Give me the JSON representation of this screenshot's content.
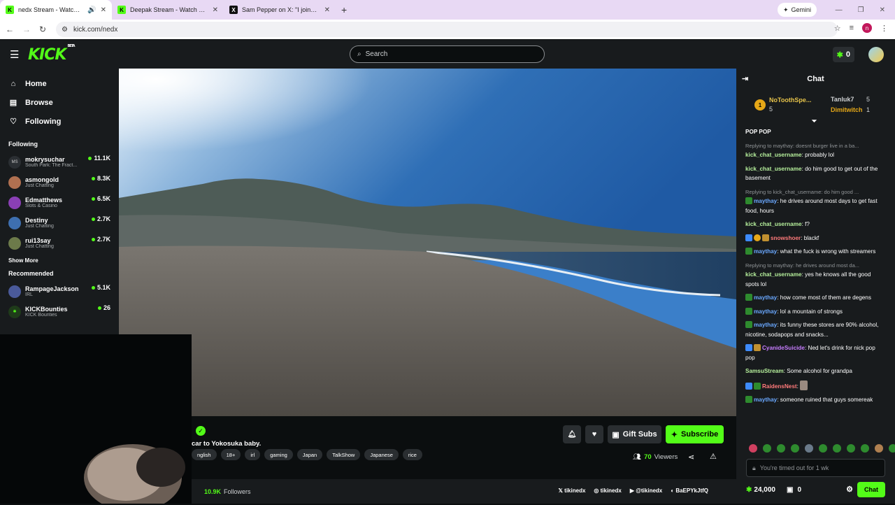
{
  "browser": {
    "tabs": [
      {
        "title": "nedx Stream - Watch Live o",
        "icon": "K"
      },
      {
        "title": "Deepak Stream - Watch Live o",
        "icon": "K"
      },
      {
        "title": "Sam Pepper on X: \"I joined a tr",
        "icon": "X"
      }
    ],
    "new_tab": "+",
    "gemini_label": "Gemini",
    "url": "kick.com/nedx",
    "profile_initial": "n"
  },
  "header": {
    "logo": "KICK",
    "logo_tag": "BETA",
    "search_placeholder": "Search",
    "kicks_count": "0"
  },
  "sidebar": {
    "nav": [
      {
        "label": "Home",
        "icon": "home-icon"
      },
      {
        "label": "Browse",
        "icon": "browse-icon"
      },
      {
        "label": "Following",
        "icon": "heart-icon"
      }
    ],
    "following_title": "Following",
    "following": [
      {
        "name": "mokrysuchar",
        "category": "South Park: The Fract...",
        "viewers": "11.1K",
        "initials": "MS"
      },
      {
        "name": "asmongold",
        "category": "Just Chatting",
        "viewers": "8.3K",
        "initials": ""
      },
      {
        "name": "Edmatthews",
        "category": "Slots & Casino",
        "viewers": "6.5K",
        "initials": ""
      },
      {
        "name": "Destiny",
        "category": "Just Chatting",
        "viewers": "2.7K",
        "initials": ""
      },
      {
        "name": "rui13say",
        "category": "Just Chatting",
        "viewers": "2.7K",
        "initials": ""
      }
    ],
    "show_more": "Show More",
    "recommended_title": "Recommended",
    "recommended": [
      {
        "name": "RampageJackson",
        "category": "IRL",
        "viewers": "5.1K",
        "initials": ""
      },
      {
        "name": "KICKBounties",
        "category": "KICK Bounties",
        "viewers": "26",
        "initials": ""
      }
    ]
  },
  "stream": {
    "title": "car to Yokosuka baby.",
    "tags": [
      "nglish",
      "18+",
      "irl",
      "gaming",
      "Japan",
      "TalkShow",
      "Japanese",
      "rice"
    ],
    "gift_subs_label": "Gift Subs",
    "subscribe_label": "Subscribe",
    "viewers_count": "70",
    "viewers_label": "Viewers",
    "followers_count": "10.9K",
    "followers_label": "Followers",
    "socials": [
      {
        "icon": "x-icon",
        "handle": "tikinedx"
      },
      {
        "icon": "instagram-icon",
        "handle": "tikinedx"
      },
      {
        "icon": "youtube-icon",
        "handle": "@tikinedx"
      },
      {
        "icon": "discord-icon",
        "handle": "BaEPYkJtfQ"
      }
    ]
  },
  "chat": {
    "title": "Chat",
    "pinned": {
      "top_rank": "1",
      "top_name": "NoToothSpe...",
      "top_count": "5",
      "second_name": "Tanluk7",
      "second_count": "5",
      "third_name": "Dimitwitch",
      "third_count": "1"
    },
    "messages": [
      {
        "reply": "",
        "user": "",
        "color": "#fff",
        "text": "POP POP"
      },
      {
        "reply": "Replying to maythay: doesnt burger live in a ba...",
        "user": "kick_chat_username",
        "color": "#b6f09c",
        "text": "probably lol"
      },
      {
        "reply": "",
        "user": "kick_chat_username",
        "color": "#b6f09c",
        "text": "do him good to get out of the basement"
      },
      {
        "reply": "Replying to kick_chat_username: do him good ...",
        "user": "maythay",
        "color": "#6aa8ff",
        "text": "he drives around most days to get fast food, hours"
      },
      {
        "reply": "",
        "user": "kick_chat_username",
        "color": "#b6f09c",
        "text": "f?"
      },
      {
        "reply": "",
        "user": "snowshoer",
        "color": "#ff7a7a",
        "text": "blackf"
      },
      {
        "reply": "",
        "user": "maythay",
        "color": "#6aa8ff",
        "text": "what the fuck is wrong with streamers"
      },
      {
        "reply": "Replying to maythay: he drives around most da...",
        "user": "kick_chat_username",
        "color": "#b6f09c",
        "text": "yes he knows all the good spots lol"
      },
      {
        "reply": "",
        "user": "maythay",
        "color": "#6aa8ff",
        "text": "how come most of them are degens"
      },
      {
        "reply": "",
        "user": "maythay",
        "color": "#6aa8ff",
        "text": "lol a mountain of strongs"
      },
      {
        "reply": "",
        "user": "maythay",
        "color": "#6aa8ff",
        "text": "its funny these stores are 90% alcohol, nicotine, sodapops and snacks..."
      },
      {
        "reply": "",
        "user": "CyanideSuicide",
        "color": "#c77dff",
        "text": "Ned let's drink for nick pop pop"
      },
      {
        "reply": "",
        "user": "SamsuStream",
        "color": "#b6f09c",
        "text": "Some alcohol for grandpa"
      },
      {
        "reply": "",
        "user": "RaidensNest",
        "color": "#ff7a7a",
        "text": ""
      },
      {
        "reply": "",
        "user": "maythay",
        "color": "#6aa8ff",
        "text": "someone ruined that guys somereak"
      }
    ],
    "input_placeholder": "You're timed out for 1 wk",
    "kicks_balance": "24,000",
    "subs_count": "0",
    "send_label": "Chat"
  }
}
